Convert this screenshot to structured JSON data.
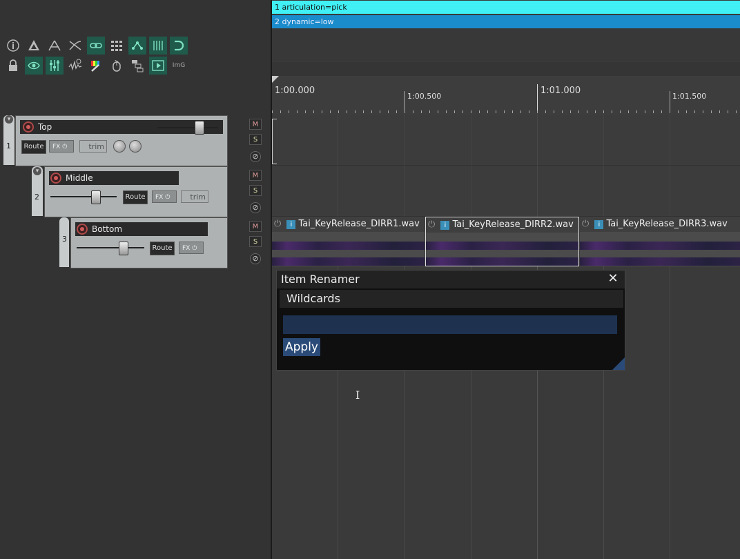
{
  "toolbar": {
    "row1": [
      "info-icon",
      "ripple-icon",
      "envelope-points-icon",
      "crossfade-icon",
      "link-icon",
      "grid-icon",
      "group-icon",
      "snap-grid-icon",
      "magnet-icon"
    ],
    "row2": [
      "lock-icon",
      "eye-icon",
      "mixer-icon",
      "envelope-visible-icon",
      "info-wave-icon",
      "color-brush-icon",
      "mouse-icon",
      "routing-icon",
      "play-icon"
    ],
    "img_label": "ImG"
  },
  "tracks": [
    {
      "number": "1",
      "name": "Top",
      "route": "Route",
      "fx": "FX",
      "trim": "trim"
    },
    {
      "number": "2",
      "name": "Middle",
      "route": "Route",
      "fx": "FX",
      "trim": "trim"
    },
    {
      "number": "3",
      "name": "Bottom",
      "route": "Route",
      "fx": "FX"
    }
  ],
  "mute_label": "M",
  "solo_label": "S",
  "phase_label": "⊘",
  "markers": [
    {
      "label": "1  articulation=pick",
      "color": "#40f0f4"
    },
    {
      "label": "2  dynamic=low",
      "color": "#1a8ccc"
    }
  ],
  "ruler": {
    "major": [
      "1:00.000",
      "1:01.000"
    ],
    "minor": [
      "1:00.500",
      "1:01.500"
    ]
  },
  "items": [
    {
      "name": "Tai_KeyRelease_DIRR1.wav"
    },
    {
      "name": "Tai_KeyRelease_DIRR2.wav"
    },
    {
      "name": "Tai_KeyRelease_DIRR3.wav"
    }
  ],
  "dialog": {
    "title": "Item Renamer",
    "close": "✕",
    "tab": "Wildcards",
    "input_value": "",
    "apply_label": "Apply"
  }
}
